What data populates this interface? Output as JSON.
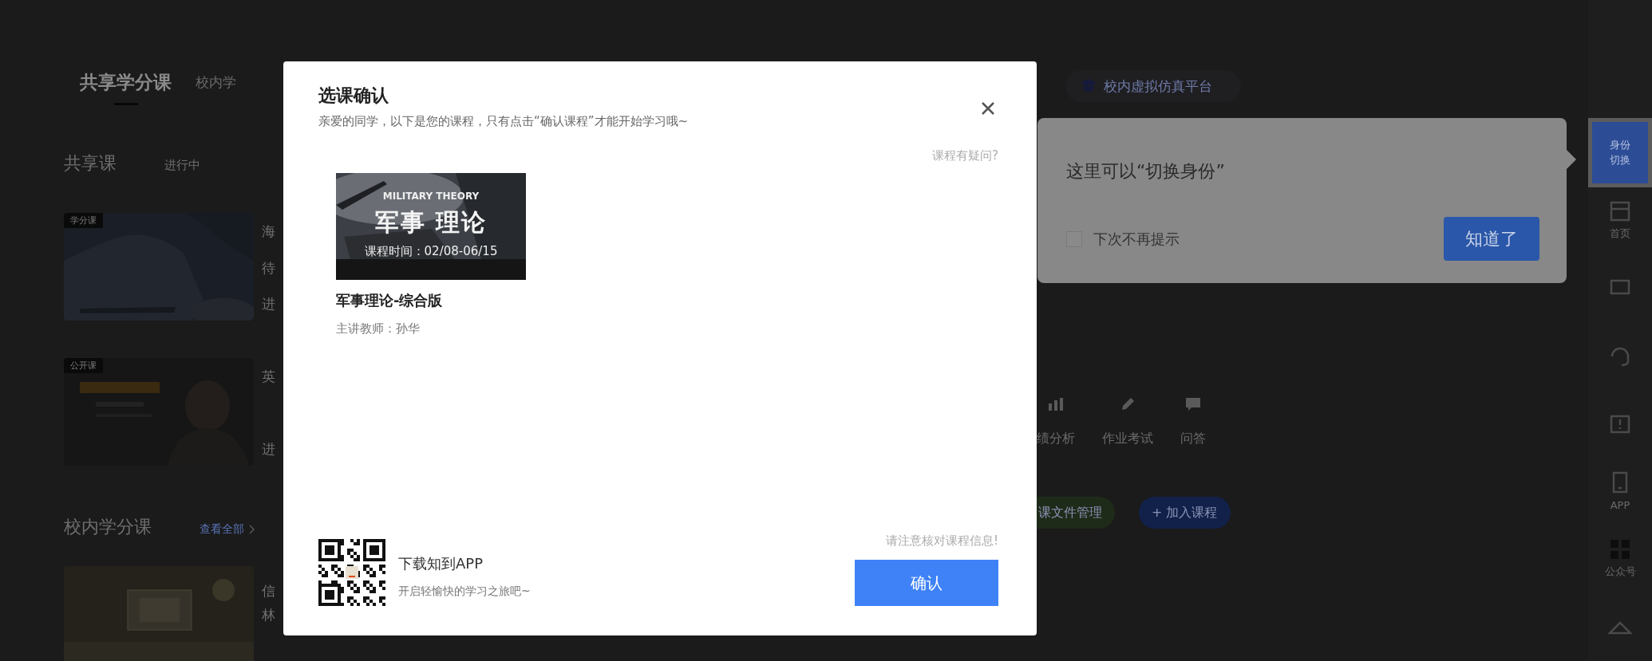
{
  "background": {
    "tabs": [
      {
        "label": "共享学分课",
        "selected": true
      },
      {
        "label": "校内学",
        "selected": false
      }
    ],
    "shared": {
      "title": "共享课",
      "filter": "进行中"
    },
    "shared_courses": [
      {
        "tag": "学分课",
        "kind": "mountain",
        "lines": [
          "海",
          "待",
          "进"
        ]
      },
      {
        "tag": "公开课",
        "kind": "lecture",
        "lines": [
          "英",
          "进"
        ]
      }
    ],
    "campus": {
      "title": "校内学分课",
      "link": "查看全部"
    },
    "campus_courses": [
      {
        "kind": "plain",
        "lines": [
          "信",
          "林"
        ]
      }
    ],
    "platform_button": "校内虚拟仿真平台",
    "tools": [
      {
        "label": "绩分析",
        "kind": "chart"
      },
      {
        "label": "作业考试",
        "kind": "pencil"
      },
      {
        "label": "问答",
        "kind": "chat"
      }
    ],
    "actions": [
      {
        "label": "课文件管理",
        "color": "#1f2b19"
      },
      {
        "label": "+ 加入课程",
        "color": "#12214a"
      }
    ]
  },
  "sidebar": [
    {
      "kind": "switch",
      "label": "身份切换",
      "highlighted": true
    },
    {
      "kind": "home",
      "label": "首页",
      "highlighted": false
    },
    {
      "kind": "message",
      "highlighted": false
    },
    {
      "kind": "headset",
      "highlighted": false
    },
    {
      "kind": "alert",
      "highlighted": false
    },
    {
      "kind": "phone",
      "label": "APP",
      "highlighted": false
    },
    {
      "kind": "qr",
      "label": "公众号",
      "highlighted": false
    },
    {
      "kind": "top",
      "highlighted": false
    }
  ],
  "dialog": {
    "title": "选课确认",
    "subtitle": "亲爱的同学，以下是您的课程，只有点击“确认课程”才能开始学习哦~",
    "help_link": "课程有疑问?",
    "course": {
      "cover": {
        "kind": "picture",
        "caption_en": "MILITARY THEORY",
        "caption": "军事 理论",
        "period": "课程时间：02/08-06/15"
      },
      "title": "军事理论-综合版",
      "teacher": "主讲教师：孙华"
    },
    "app": {
      "title": "下载知到APP",
      "subtitle": "开启轻愉快的学习之旅吧~"
    },
    "notice": "请注意核对课程信息!",
    "confirm_button": "确认"
  },
  "tooltip": {
    "text": "这里可以“切换身份”",
    "checkbox": {
      "label": "下次不再提示",
      "checked": false
    },
    "button": "知道了"
  }
}
